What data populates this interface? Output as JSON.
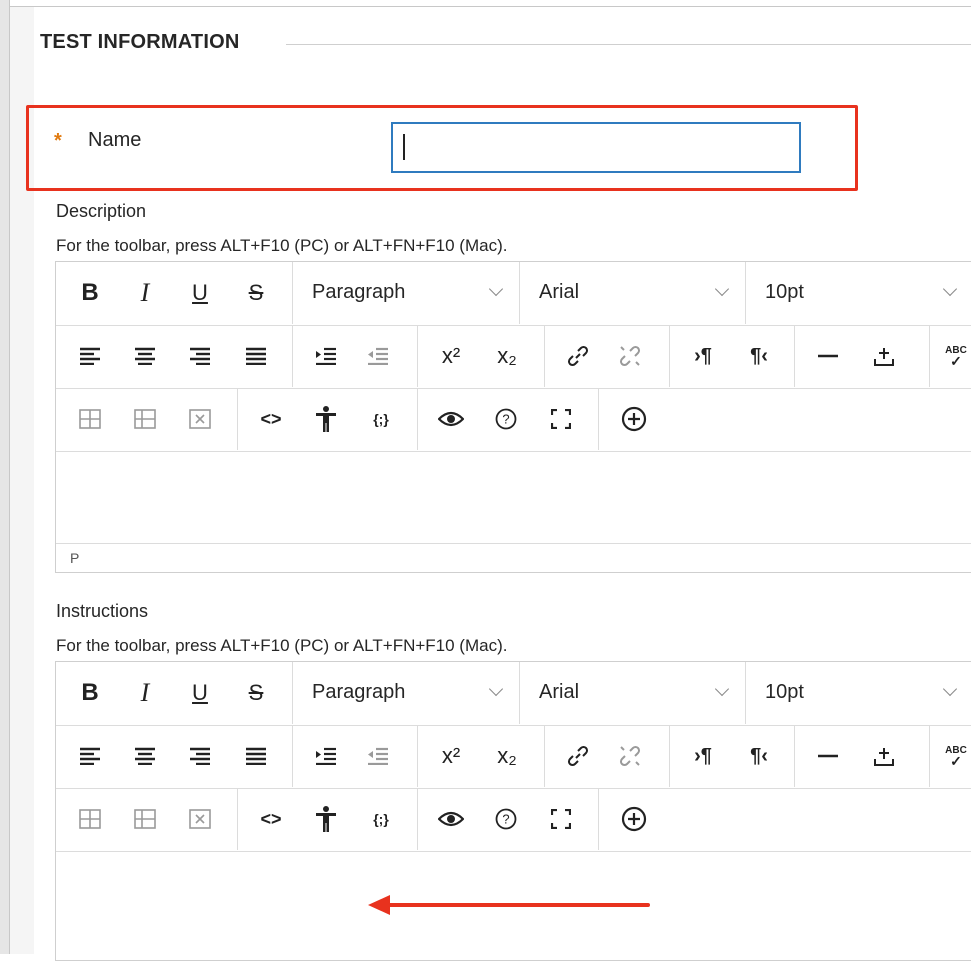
{
  "section": {
    "title": "TEST INFORMATION"
  },
  "name_field": {
    "required_marker": "*",
    "label": "Name",
    "value": ""
  },
  "description": {
    "label": "Description",
    "hint": "For the toolbar, press ALT+F10 (PC) or ALT+FN+F10 (Mac).",
    "status": "P"
  },
  "instructions": {
    "label": "Instructions",
    "hint": "For the toolbar, press ALT+F10 (PC) or ALT+FN+F10 (Mac)."
  },
  "toolbar": {
    "bold": "B",
    "italic": "I",
    "underline": "U",
    "strike": "S",
    "block_format": "Paragraph",
    "font_family": "Arial",
    "font_size": "10pt",
    "superscript": "x²",
    "subscript": "x₂",
    "ltr": "›¶",
    "rtl": "¶‹",
    "code": "<>",
    "source": "{;}",
    "spellcheck": "ABC"
  },
  "colors": {
    "accent_border": "#e8321e",
    "input_focus": "#2f7bbf",
    "required": "#e07a10"
  }
}
